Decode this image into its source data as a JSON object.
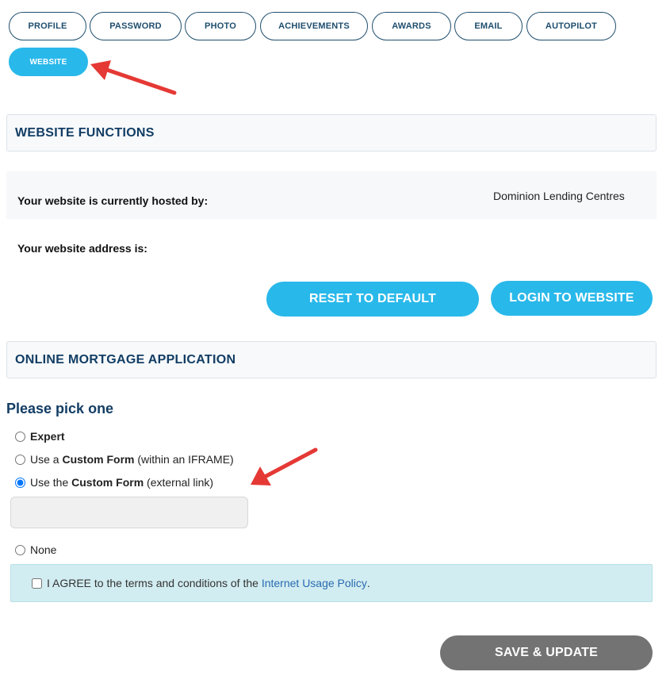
{
  "tabs": {
    "profile": "PROFILE",
    "password": "PASSWORD",
    "photo": "PHOTO",
    "achievements": "ACHIEVEMENTS",
    "awards": "AWARDS",
    "email": "EMAIL",
    "autopilot": "AUTOPILOT",
    "website": "WEBSITE"
  },
  "website_functions": {
    "title": "WEBSITE FUNCTIONS",
    "hosted_label": "Your website is currently hosted by:",
    "hosted_value": "Dominion Lending Centres",
    "address_label": "Your website address is:",
    "reset_button": "RESET TO DEFAULT",
    "login_button": "LOGIN TO WEBSITE"
  },
  "mortgage": {
    "title": "ONLINE MORTGAGE APPLICATION",
    "pick_title": "Please pick one",
    "option_expert": "Expert",
    "option_iframe_prefix": "Use a",
    "option_iframe_bold": "Custom Form",
    "option_iframe_suffix": "(within an IFRAME)",
    "option_external_prefix": "Use the",
    "option_external_bold": "Custom Form",
    "option_external_suffix": "(external link)",
    "external_link_value": "",
    "option_none": "None",
    "agree_text": "I AGREE to the terms and conditions of the",
    "agree_link": "Internet Usage Policy",
    "agree_period": ".",
    "save_button": "SAVE & UPDATE"
  },
  "colors": {
    "accent": "#29b8ea",
    "heading": "#123d64",
    "annotation_arrow": "#e53935",
    "save_button": "#737373"
  }
}
